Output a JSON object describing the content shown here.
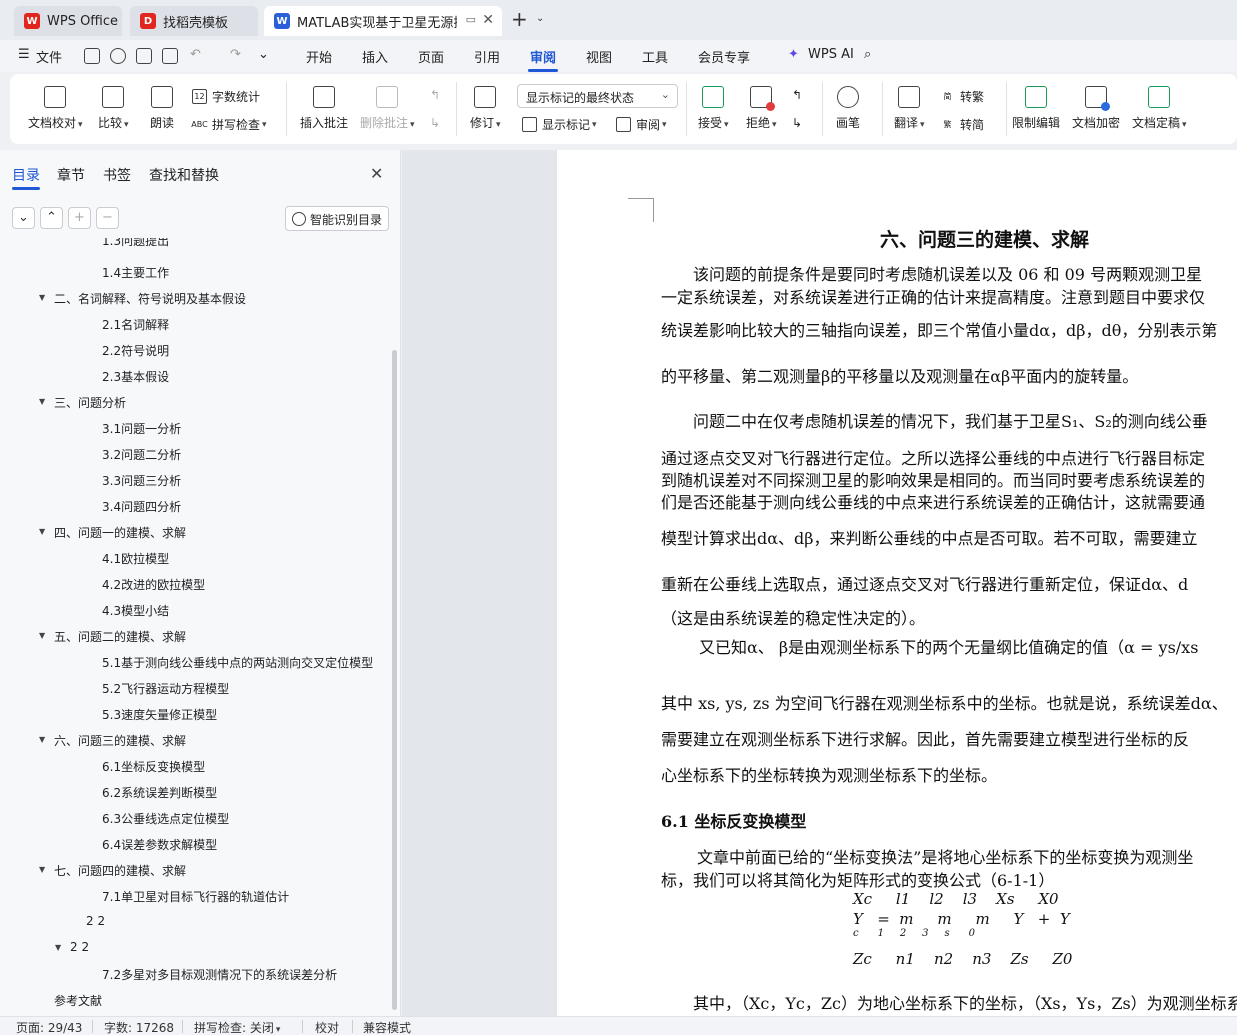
{
  "tabs": [
    {
      "label": "WPS Office",
      "icon": "wps-logo-icon",
      "color": "#e0261e"
    },
    {
      "label": "找稻壳模板",
      "icon": "docer-icon",
      "color": "#e0261e"
    },
    {
      "label": "MATLAB实现基于卫星无源探",
      "icon": "word-doc-icon",
      "color": "#2b5fd9"
    }
  ],
  "menubar": {
    "file": "文件",
    "items": [
      "开始",
      "插入",
      "页面",
      "引用",
      "审阅",
      "视图",
      "工具",
      "会员专享"
    ],
    "active": "审阅",
    "ai": "WPS AI"
  },
  "ribbon": {
    "doc_check": "文档校对",
    "compare": "比较",
    "read_aloud": "朗读",
    "word_count": "字数统计",
    "spell_check": "拼写检查",
    "insert_comment": "插入批注",
    "delete_comment": "删除批注",
    "revise": "修订",
    "markup_state": "显示标记的最终状态",
    "show_markup": "显示标记",
    "review": "审阅",
    "accept": "接受",
    "reject": "拒绝",
    "pen": "画笔",
    "translate": "翻译",
    "to_traditional": "转繁",
    "to_simplified": "转简",
    "restrict_edit": "限制编辑",
    "encrypt": "文档加密",
    "finalize": "文档定稿"
  },
  "sidebar": {
    "tabs": [
      "目录",
      "章节",
      "书签",
      "查找和替换"
    ],
    "smart_toc": "智能识别目录",
    "toc": [
      {
        "label": "1.3问题提出",
        "level": 3
      },
      {
        "label": "1.4主要工作",
        "level": 3
      },
      {
        "label": "二、名词解释、符号说明及基本假设",
        "level": 1
      },
      {
        "label": "2.1名词解释",
        "level": 3
      },
      {
        "label": "2.2符号说明",
        "level": 3
      },
      {
        "label": "2.3基本假设",
        "level": 3
      },
      {
        "label": "三、问题分析",
        "level": 1
      },
      {
        "label": "3.1问题一分析",
        "level": 3
      },
      {
        "label": "3.2问题二分析",
        "level": 3
      },
      {
        "label": "3.3问题三分析",
        "level": 3
      },
      {
        "label": "3.4问题四分析",
        "level": 3
      },
      {
        "label": "四、问题一的建模、求解",
        "level": 1
      },
      {
        "label": "4.1欧拉模型",
        "level": 3
      },
      {
        "label": "4.2改进的欧拉模型",
        "level": 3
      },
      {
        "label": "4.3模型小结",
        "level": 3
      },
      {
        "label": "五、问题二的建模、求解",
        "level": 1
      },
      {
        "label": "5.1基于测向线公垂线中点的两站测向交叉定位模型",
        "level": 3
      },
      {
        "label": "5.2飞行器运动方程模型",
        "level": 3
      },
      {
        "label": "5.3速度矢量修正模型",
        "level": 3
      },
      {
        "label": "六、问题三的建模、求解",
        "level": 1
      },
      {
        "label": "6.1坐标反变换模型",
        "level": 3
      },
      {
        "label": "6.2系统误差判断模型",
        "level": 3
      },
      {
        "label": "6.3公垂线选点定位模型",
        "level": 3
      },
      {
        "label": "6.4误差参数求解模型",
        "level": 3
      },
      {
        "label": "七、问题四的建模、求解",
        "level": 1
      },
      {
        "label": "7.1单卫星对目标飞行器的轨道估计",
        "level": 3
      },
      {
        "label": "2 2",
        "level": 2
      },
      {
        "label": "2 2",
        "level": 1.5
      },
      {
        "label": "7.2多星对多目标观测情况下的系统误差分析",
        "level": 3
      },
      {
        "label": "参考文献",
        "level": 0
      }
    ]
  },
  "document": {
    "title": "六、问题三的建模、求解",
    "lines": [
      "该问题的前提条件是要同时考虑随机误差以及  06 和 09 号两颗观测卫星",
      "一定系统误差，对系统误差进行正确的估计来提高精度。注意到题目中要求仅",
      "统误差影响比较大的三轴指向误差，即三个常值小量dα，dβ，dθ，分别表示第",
      "的平移量、第二观测量β的平移量以及观测量在αβ平面内的旋转量。",
      "问题二中在仅考虑随机误差的情况下，我们基于卫星S₁、S₂的测向线公垂",
      "通过逐点交叉对飞行器进行定位。之所以选择公垂线的中点进行飞行器目标定",
      "到随机误差对不同探测卫星的影响效果是相同的。而当同时要考虑系统误差的",
      "们是否还能基于测向线公垂线的中点来进行系统误差的正确估计，这就需要通",
      "模型计算求出dα、dβ，来判断公垂线的中点是否可取。若不可取，需要建立",
      "重新在公垂线上选取点，通过逐点交叉对飞行器进行重新定位，保证dα、d",
      "（这是由系统误差的稳定性决定的）。",
      "又已知α、 β是由观测坐标系下的两个无量纲比值确定的值（α = ys/xs",
      "其中 xs, ys, zs 为空间飞行器在观测坐标系中的坐标。也就是说，系统误差dα、",
      "需要建立在观测坐标系下进行求解。因此，首先需要建立模型进行坐标的反",
      "心坐标系下的坐标转换为观测坐标系下的坐标。"
    ],
    "section": "6.1  坐标反变换模型",
    "lines2": [
      "文章中前面已给的“坐标变换法”是将地心坐标系下的坐标变换为观测坐",
      "标，我们可以将其简化为矩阵形式的变换公式（6-1-1）"
    ],
    "matrix": {
      "row1": "Xc     l1    l2    l3    Xs     X0",
      "row2": "Y   =  m     m     m     Y   +  Y",
      "row3": "c      1     2     3     s      0",
      "row4": "Zc     n1    n2    n3    Zs     Z0"
    },
    "last_line": "其中，（Xc，Yc，Zc）为地心坐标系下的坐标，（Xs，Ys，Zs）为观测坐标系"
  },
  "status": {
    "page": "页面: 29/43",
    "words": "字数: 17268",
    "spell": "拼写检查: 关闭",
    "proof": "校对",
    "compat": "兼容模式"
  }
}
